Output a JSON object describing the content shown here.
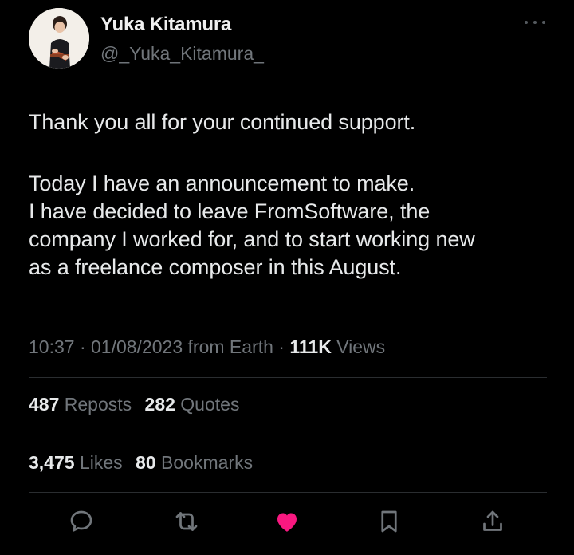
{
  "author": {
    "name": "Yuka Kitamura",
    "handle": "@_Yuka_Kitamura_"
  },
  "tweet": {
    "line1": "Thank you all for your continued support.",
    "para2": [
      "Today I have an announcement to make.",
      "I have decided to leave FromSoftware, the",
      "company I worked for, and to start working new",
      "as a freelance composer in this August."
    ]
  },
  "meta": {
    "time": "10:37",
    "date": "01/08/2023",
    "source": "from Earth",
    "views_count": "111K",
    "views_label": "Views"
  },
  "stats": {
    "reposts_count": "487",
    "reposts_label": "Reposts",
    "quotes_count": "282",
    "quotes_label": "Quotes",
    "likes_count": "3,475",
    "likes_label": "Likes",
    "bookmarks_count": "80",
    "bookmarks_label": "Bookmarks"
  },
  "actions": [
    "reply-icon",
    "repost-icon",
    "like-icon",
    "bookmark-icon",
    "share-icon"
  ],
  "colors": {
    "like": "#f91880",
    "muted": "#71767b",
    "text": "#e7e9ea",
    "background": "#000000"
  }
}
